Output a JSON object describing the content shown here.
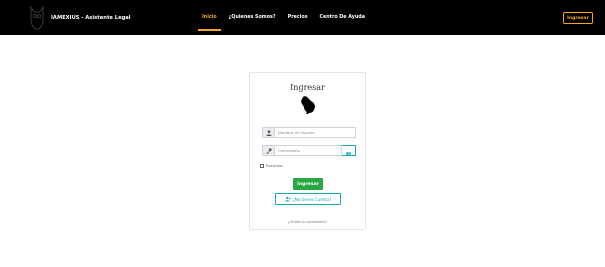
{
  "colors": {
    "navbar_bg": "#000000",
    "accent": "#f5a623",
    "success": "#28a745",
    "info": "#17a2b8"
  },
  "brand": {
    "logo_icon": "owl-logo-icon",
    "name": "IAMEXIUS - Asistente Legal"
  },
  "nav": {
    "items": [
      {
        "label": "Inicio",
        "active": true
      },
      {
        "label": "¿Quienes Somos?",
        "active": false
      },
      {
        "label": "Precios",
        "active": false
      },
      {
        "label": "Centro De Ayuda",
        "active": false
      }
    ],
    "login_button": "Ingresar"
  },
  "login_card": {
    "title": "Ingresar",
    "illustration_icon": "hand-pointing-icon",
    "username": {
      "icon": "user-icon",
      "placeholder": "Nombre de Usuario",
      "value": ""
    },
    "password": {
      "icon": "key-icon",
      "placeholder": "Contraseña",
      "value": "",
      "toggle_icon": "eye-icon"
    },
    "remember_label": "Recordar",
    "remember_checked": false,
    "submit_label": "Ingresar",
    "register_icon": "add-user-icon",
    "register_label": "¿No tienes Cuenta?",
    "forgot_label": "¿Olvidó su contraseña?"
  }
}
